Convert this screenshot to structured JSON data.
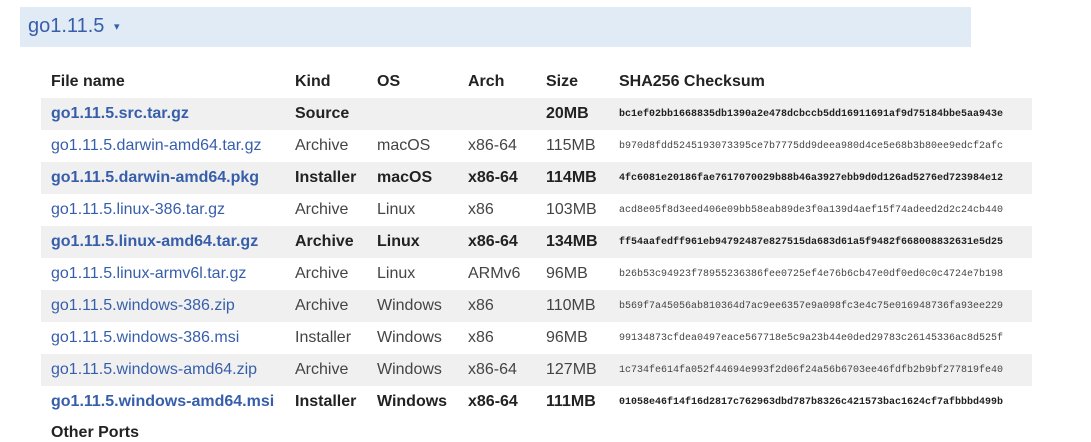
{
  "release": {
    "title": "go1.11.5",
    "toggle_icon": "▾"
  },
  "table": {
    "headers": [
      "File name",
      "Kind",
      "OS",
      "Arch",
      "Size",
      "SHA256 Checksum"
    ],
    "rows": [
      {
        "file": "go1.11.5.src.tar.gz",
        "kind": "Source",
        "os": "",
        "arch": "",
        "size": "20MB",
        "sha": "bc1ef02bb1668835db1390a2e478dcbccb5dd16911691af9d75184bbe5aa943e",
        "highlight": true
      },
      {
        "file": "go1.11.5.darwin-amd64.tar.gz",
        "kind": "Archive",
        "os": "macOS",
        "arch": "x86-64",
        "size": "115MB",
        "sha": "b970d8fdd5245193073395ce7b7775dd9deea980d4ce5e68b3b80ee9edcf2afc",
        "highlight": false
      },
      {
        "file": "go1.11.5.darwin-amd64.pkg",
        "kind": "Installer",
        "os": "macOS",
        "arch": "x86-64",
        "size": "114MB",
        "sha": "4fc6081e20186fae7617070029b88b46a3927ebb9d0d126ad5276ed723984e12",
        "highlight": true
      },
      {
        "file": "go1.11.5.linux-386.tar.gz",
        "kind": "Archive",
        "os": "Linux",
        "arch": "x86",
        "size": "103MB",
        "sha": "acd8e05f8d3eed406e09bb58eab89de3f0a139d4aef15f74adeed2d2c24cb440",
        "highlight": false
      },
      {
        "file": "go1.11.5.linux-amd64.tar.gz",
        "kind": "Archive",
        "os": "Linux",
        "arch": "x86-64",
        "size": "134MB",
        "sha": "ff54aafedff961eb94792487e827515da683d61a5f9482f668008832631e5d25",
        "highlight": true
      },
      {
        "file": "go1.11.5.linux-armv6l.tar.gz",
        "kind": "Archive",
        "os": "Linux",
        "arch": "ARMv6",
        "size": "96MB",
        "sha": "b26b53c94923f78955236386fee0725ef4e76b6cb47e0df0ed0c0c4724e7b198",
        "highlight": false
      },
      {
        "file": "go1.11.5.windows-386.zip",
        "kind": "Archive",
        "os": "Windows",
        "arch": "x86",
        "size": "110MB",
        "sha": "b569f7a45056ab810364d7ac9ee6357e9a098fc3e4c75e016948736fa93ee229",
        "highlight": false
      },
      {
        "file": "go1.11.5.windows-386.msi",
        "kind": "Installer",
        "os": "Windows",
        "arch": "x86",
        "size": "96MB",
        "sha": "99134873cfdea0497eace567718e5c9a23b44e0ded29783c26145336ac8d525f",
        "highlight": false
      },
      {
        "file": "go1.11.5.windows-amd64.zip",
        "kind": "Archive",
        "os": "Windows",
        "arch": "x86-64",
        "size": "127MB",
        "sha": "1c734fe614fa052f44694e993f2d06f24a56b6703ee46fdfb2b9bf277819fe40",
        "highlight": false
      },
      {
        "file": "go1.11.5.windows-amd64.msi",
        "kind": "Installer",
        "os": "Windows",
        "arch": "x86-64",
        "size": "111MB",
        "sha": "01058e46f14f16d2817c762963dbd787b8326c421573bac1624cf7afbbbd499b",
        "highlight": true
      }
    ]
  },
  "other_ports_label": "Other Ports"
}
